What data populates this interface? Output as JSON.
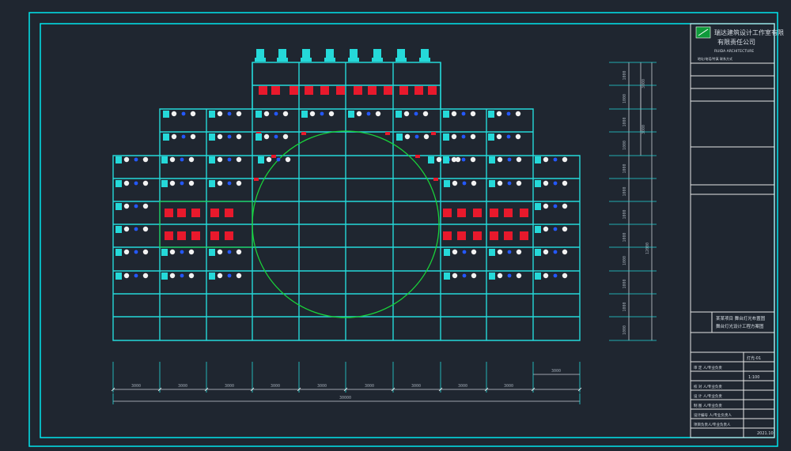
{
  "title_block": {
    "company_line1": "瑞达建筑设计工作室有限",
    "company_line2": "有限责任公司",
    "company_line3": "RUIDA ARCHITECTURE",
    "contact": "地址/电话/传真 联系方式",
    "project_line1": "某某项目 舞台灯光布置图",
    "project_line2": "舞台灯光设计工程方案图",
    "drawing_no": "灯光-01",
    "scale_value": "1:100",
    "date_value": "2021.10",
    "rows": [
      "审 定 人/专业负责",
      "校 对 人/专业负责",
      "设 计 人/专业负责",
      "制 图 人/专业负责",
      "设计编号 人/专业负责人",
      "项目负责人/专业负责人"
    ]
  },
  "dimensions": {
    "bottom_spans": [
      "3000",
      "3000",
      "3000",
      "3000",
      "3000",
      "3000",
      "3000",
      "3000",
      "3000",
      "3000"
    ],
    "total": "30000",
    "right_extra": "3000",
    "right_rows": [
      "1000",
      "1000",
      "1000",
      "1000",
      "1000",
      "1000",
      "1000",
      "1000",
      "1000",
      "1000",
      "1000",
      "1000"
    ],
    "right_group_a": "3000",
    "right_group_b": "3000",
    "right_total": "12000"
  },
  "colors": {
    "frame": "#00e5ee",
    "grid": "#25d9d9",
    "circle": "#19d23a",
    "red_fixture": "#e8192c",
    "white_fixture": "#f2f2f2",
    "blue_fixture": "#2458ff",
    "dims": "#c9ced4"
  }
}
